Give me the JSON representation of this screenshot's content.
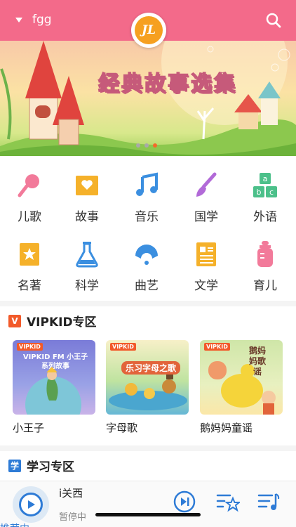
{
  "header": {
    "username": "fgg",
    "logo_text": "JL"
  },
  "banner": {
    "title": "经典故事选集",
    "slide_count": 3,
    "active_slide": 3
  },
  "categories": [
    {
      "label": "儿歌",
      "icon": "microphone-icon"
    },
    {
      "label": "故事",
      "icon": "book-heart-icon"
    },
    {
      "label": "音乐",
      "icon": "music-note-icon"
    },
    {
      "label": "国学",
      "icon": "brush-icon"
    },
    {
      "label": "外语",
      "icon": "abc-blocks-icon"
    },
    {
      "label": "名著",
      "icon": "star-book-icon"
    },
    {
      "label": "科学",
      "icon": "flask-icon"
    },
    {
      "label": "曲艺",
      "icon": "fan-icon"
    },
    {
      "label": "文学",
      "icon": "document-icon"
    },
    {
      "label": "育儿",
      "icon": "baby-bottle-icon"
    }
  ],
  "vipkid_section": {
    "badge": "V",
    "title": "VIPKID专区",
    "cards": [
      {
        "name": "小王子",
        "cover_text": "VIPKID FM 小王子系列故事",
        "badge": "VIPKID"
      },
      {
        "name": "字母歌",
        "cover_text": "乐习字母之歌",
        "badge": "VIPKID"
      },
      {
        "name": "鹅妈妈童谣",
        "cover_text": "鹅妈妈歌谣",
        "badge": "VIPKID"
      }
    ]
  },
  "study_section": {
    "badge": "学",
    "title": "学习专区"
  },
  "player": {
    "title": "i关西",
    "status": "暂停中"
  },
  "peek_text": "推荐内",
  "colors": {
    "header": "#f36a8a",
    "accent_blue": "#2e7bd6",
    "vipkid_orange": "#f25a2a"
  }
}
